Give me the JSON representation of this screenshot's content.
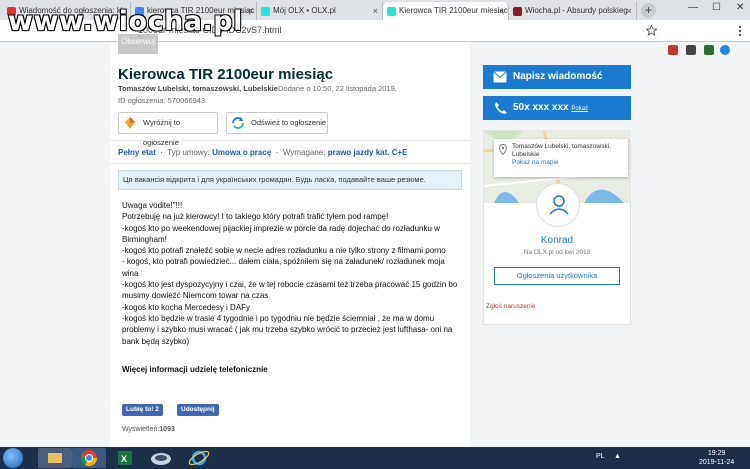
{
  "watermark": "www.wiocha.pl",
  "browser": {
    "tabs": [
      {
        "label": "Wiadomość do ogłoszenia: ki",
        "color": "#e03030"
      },
      {
        "label": "kierowca TIR 2100eur miesiąc",
        "color": "#4285f4"
      },
      {
        "label": "Mój OLX • OLX.pl",
        "color": "#23e5db"
      },
      {
        "label": "Kierowca TIR 2100eur miesiąc",
        "color": "#23e5db"
      },
      {
        "label": "Wiocha.pl - Absurdy polskieg",
        "color": "#8b1a1a"
      }
    ],
    "close_glyph": "×",
    "new_tab": "+",
    "url": "100eur-miesiac-CID4-IDC2vS7.html",
    "window_controls": [
      "—",
      "☐",
      "✕"
    ]
  },
  "ad": {
    "observe_label": "Obserwuj",
    "title": "Kierowca TIR 2100eur miesiąc",
    "location": "Tomaszów Lubelski, tomaszowski, Lubelskie",
    "added": "Dodane o 10:50, 22 listopada 2019,",
    "ad_id": "ID ogłoszenia: 570066943",
    "promote_label": "Wyróżnij to ogłoszenie",
    "refresh_label": "Odśwież to ogłoszenie",
    "attr_1_value": "Pełny etat",
    "attr_2_key": "Typ umowy:",
    "attr_2_value": "Umowa o pracę",
    "attr_3_key": "Wymagane:",
    "attr_3_value": "prawo jazdy kat. C+E",
    "info_banner": "Ця вакансія відкрита і для українських громадян. Будь ласка, подавайте ваше резюме.",
    "description": [
      "Uwaga vodite!\"!!!",
      "Potrzebuję na już kierowcy! I to takiego który potrafi trafić tyłem pod rampę!",
      "-kogoś kto po weekendowej pijackiej imprezie w porcie da radę dojechać do rozładunku w Birmingham!",
      "-kogoś kto potrafi znaleźć sobie w necie adres rozładunku a nie tylko strony z filmami porno",
      "- kogoś, kto potrafi powiedzieć... dałem ciała, spóźniłem się na załadunek/ rozładunek moja wina",
      "-kogoś kto jest dyspozycyjny i czai, że w tej robocie czasami też trzeba pracować 15 godzin bo musimy dowieźć Niemcom towar na czas",
      "-kogoś kto kocha Mercedesy i DAFy",
      "-kogoś kto będzie w trasie 4 tygodnie i po tygodniu nie będzie ściemniał , że ma w domu problemy i szybko musi wracać ( jak mu trzeba szybko wrócić to przecież jest lufthasa- oni na bank będą szybko)"
    ],
    "more_info": "Więcej informacji udzielę telefonicznie",
    "fb_like": "Lubię to! 2",
    "fb_share": "Udostępnij",
    "views_label": "Wyświetleń:",
    "views_count": "1093"
  },
  "sidebar": {
    "message_button": "Napisz wiadomość",
    "phone_number": "50x xxx xxx",
    "phone_show": "Pokaż",
    "map_location": "Tomaszów Lubelski, tomaszowski, Lubelskie",
    "map_link": "Pokaż na mapie",
    "user_name": "Konrad",
    "user_since": "Na OLX.pl od kwi 2013",
    "user_ads_button": "Ogłoszenia użytkownika",
    "report": "Zgłoś naruszenie"
  },
  "taskbar": {
    "lang": "PL",
    "time": "19:29",
    "date": "2019-11-24"
  }
}
